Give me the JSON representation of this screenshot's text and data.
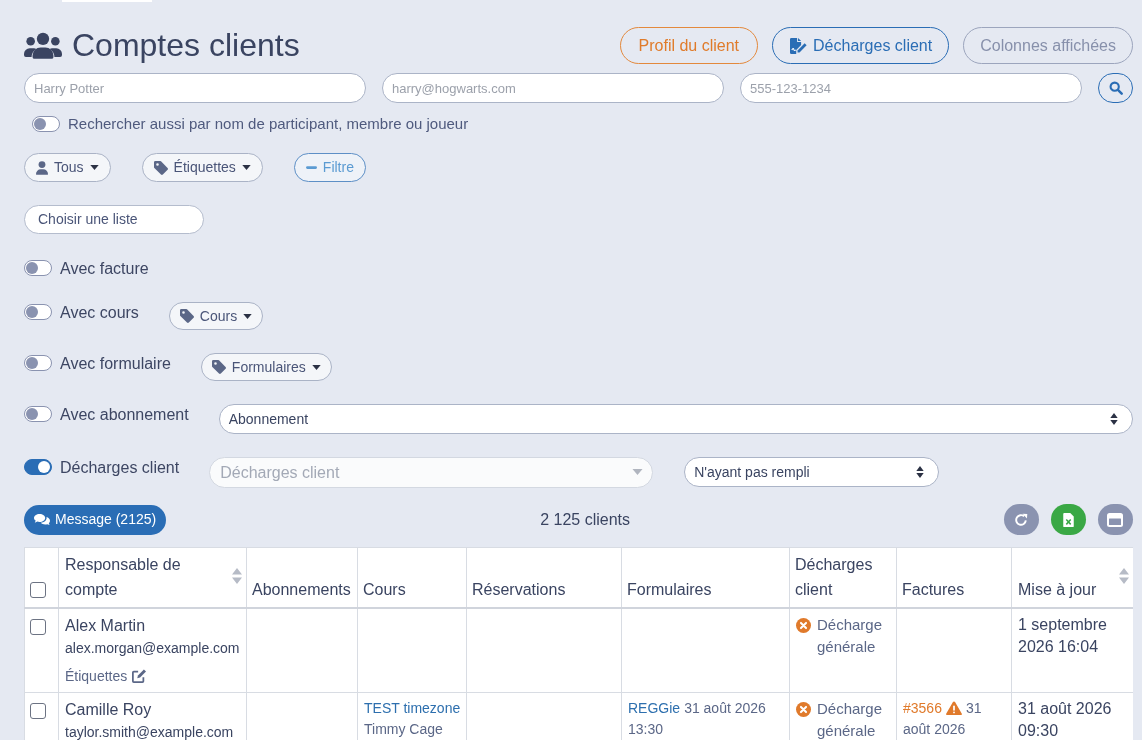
{
  "page": {
    "title": "Comptes clients"
  },
  "header_buttons": [
    {
      "label": "Profil du client",
      "kind": "accent"
    },
    {
      "label": "Décharges client",
      "kind": "primary"
    },
    {
      "label": "Colonnes affichées",
      "kind": "muted"
    }
  ],
  "search": {
    "fields": [
      {
        "placeholder": "Harry Potter"
      },
      {
        "placeholder": "harry@hogwarts.com"
      },
      {
        "placeholder": "555-123-1234"
      }
    ],
    "extended": {
      "label": "Rechercher aussi par nom de participant, membre ou joueur",
      "on": false
    }
  },
  "filter_buttons": [
    {
      "label": "Tous",
      "kind": "menu"
    },
    {
      "label": "Étiquettes",
      "kind": "menu"
    },
    {
      "label": "Filtre",
      "kind": "toggle"
    }
  ],
  "list_select": {
    "value": "Choisir une liste"
  },
  "conditions": [
    {
      "label": "Avec facture",
      "on": false
    },
    {
      "label": "Avec cours",
      "on": false,
      "controls": [
        {
          "kind": "tags",
          "label": "Cours"
        }
      ]
    },
    {
      "label": "Avec formulaire",
      "on": false,
      "controls": [
        {
          "kind": "tags",
          "label": "Formulaires"
        }
      ]
    },
    {
      "label": "Avec abonnement",
      "on": false,
      "controls": [
        {
          "kind": "select",
          "value": "Abonnement"
        }
      ]
    },
    {
      "label": "Décharges client",
      "on": true,
      "controls": [
        {
          "kind": "multiselect",
          "placeholder": "Décharges client"
        },
        {
          "kind": "select",
          "value": "N'ayant pas rempli"
        }
      ]
    }
  ],
  "actions": {
    "message_button": "Message (2125)",
    "count": "2 125 clients"
  },
  "table": {
    "select_all": {
      "checked": false
    },
    "columns": [
      {
        "label": "Responsable de compte",
        "sortable": true
      },
      {
        "label": "Abonnements",
        "sortable": false
      },
      {
        "label": "Cours",
        "sortable": false
      },
      {
        "label": "Réservations",
        "sortable": false
      },
      {
        "label": "Formulaires",
        "sortable": false
      },
      {
        "label": "Décharges client",
        "sortable": false
      },
      {
        "label": "Factures",
        "sortable": false
      },
      {
        "label": "Mise à jour",
        "sortable": true
      }
    ],
    "rows": [
      {
        "checked": false,
        "name": "Alex Martin",
        "email": "alex.morgan@example.com",
        "tags_link": "Étiquettes",
        "waivers": [
          {
            "label": "Décharge générale",
            "signed": false
          }
        ],
        "updated": "1 septembre 2026 16:04"
      },
      {
        "checked": false,
        "name": "Camille Roy",
        "email": "taylor.smith@example.com",
        "courses": [
          {
            "title": "TEST timezone",
            "instructor": "Timmy Cage"
          }
        ],
        "forms": [
          {
            "title": "REGGie",
            "date": "31 août 2026 13:30"
          }
        ],
        "waivers": [
          {
            "label": "Décharge générale",
            "signed": false
          }
        ],
        "invoices": [
          {
            "number": "#3566",
            "overdue": true,
            "date": "31 août 2026"
          }
        ],
        "updated": "31 août 2026 09:30"
      }
    ]
  }
}
